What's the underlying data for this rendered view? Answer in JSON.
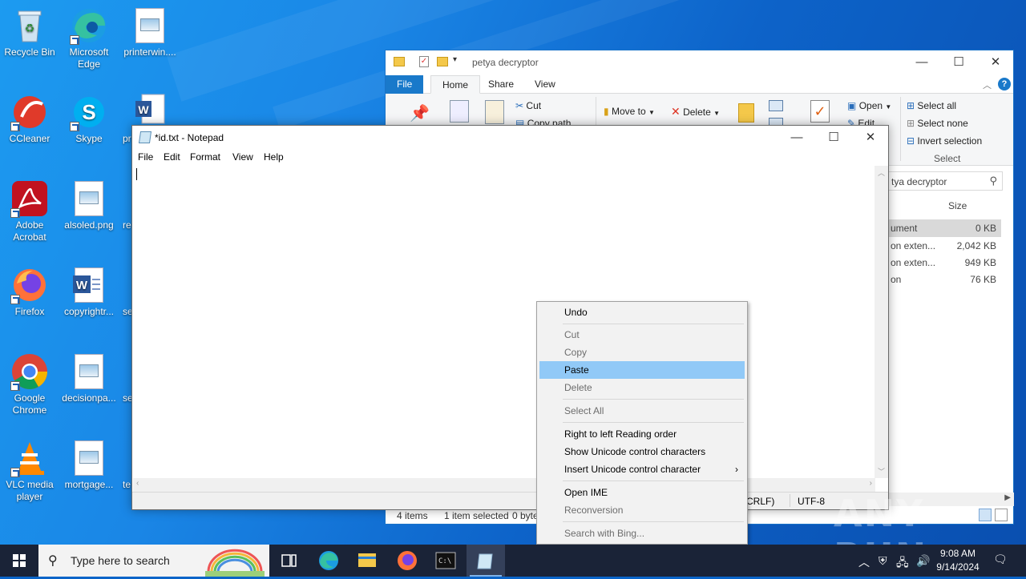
{
  "desktop": {
    "icons": [
      {
        "label": "Recycle Bin"
      },
      {
        "label": "Microsoft Edge"
      },
      {
        "label": "printerwin...."
      },
      {
        "label": "CCleaner"
      },
      {
        "label": "Skype"
      },
      {
        "label": "pr"
      },
      {
        "label": "Adobe Acrobat"
      },
      {
        "label": "alsoled.png"
      },
      {
        "label": "re"
      },
      {
        "label": "Firefox"
      },
      {
        "label": "copyrightr..."
      },
      {
        "label": "se"
      },
      {
        "label": "Google Chrome"
      },
      {
        "label": "decisionpa..."
      },
      {
        "label": "se"
      },
      {
        "label": "VLC media player"
      },
      {
        "label": "mortgage..."
      },
      {
        "label": "te"
      }
    ]
  },
  "explorer": {
    "title": "petya decryptor",
    "tabs": {
      "file": "File",
      "home": "Home",
      "share": "Share",
      "view": "View"
    },
    "ribbon": {
      "cut": "Cut",
      "copy_path": "Copy path",
      "move_to": "Move to",
      "delete": "Delete",
      "open": "Open",
      "edit": "Edit",
      "select_all": "Select all",
      "select_none": "Select none",
      "invert_selection": "Invert selection",
      "select_group": "Select"
    },
    "search_placeholder": "tya decryptor",
    "column_size": "Size",
    "files": [
      {
        "type": "ument",
        "size": "0 KB"
      },
      {
        "type": "on exten...",
        "size": "2,042 KB"
      },
      {
        "type": "on exten...",
        "size": "949 KB"
      },
      {
        "type": "on",
        "size": "76 KB"
      }
    ],
    "status": {
      "items": "4 items",
      "selected": "1 item selected",
      "bytes": "0 byte"
    }
  },
  "notepad": {
    "title": "*id.txt - Notepad",
    "menu": [
      {
        "label": "File"
      },
      {
        "label": "Edit"
      },
      {
        "label": "Format"
      },
      {
        "label": "View"
      },
      {
        "label": "Help"
      }
    ],
    "status": {
      "eol": "(CRLF)",
      "encoding": "UTF-8"
    }
  },
  "context_menu": {
    "items": [
      {
        "label": "Undo",
        "enabled": true
      },
      {
        "label": "Cut",
        "enabled": false
      },
      {
        "label": "Copy",
        "enabled": false
      },
      {
        "label": "Paste",
        "enabled": true
      },
      {
        "label": "Delete",
        "enabled": false
      },
      {
        "label": "Select All",
        "enabled": false
      },
      {
        "label": "Right to left Reading order",
        "enabled": true
      },
      {
        "label": "Show Unicode control characters",
        "enabled": true
      },
      {
        "label": "Insert Unicode control character",
        "enabled": true
      },
      {
        "label": "Open IME",
        "enabled": true
      },
      {
        "label": "Reconversion",
        "enabled": false
      },
      {
        "label": "Search with Bing...",
        "enabled": false
      }
    ],
    "highlighted": "Paste"
  },
  "taskbar": {
    "search_placeholder": "Type here to search",
    "time": "9:08 AM",
    "date": "9/14/2024",
    "apps": [
      "task-view",
      "edge",
      "file-explorer",
      "firefox",
      "cmd",
      "notepad"
    ]
  },
  "watermark": "ANY RUN",
  "colors": {
    "accent": "#1979ca",
    "menu_highlight": "#91c9f7",
    "taskbar": "#1a2337"
  }
}
